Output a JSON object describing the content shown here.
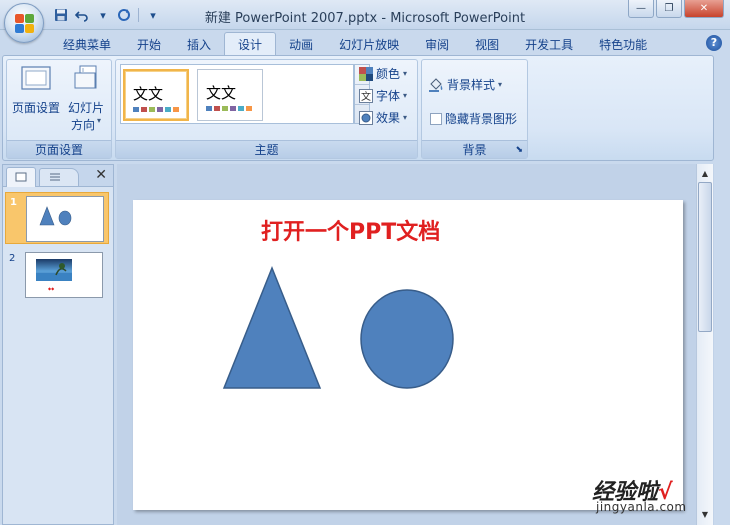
{
  "window": {
    "title": "新建 PowerPoint 2007.pptx - Microsoft PowerPoint",
    "minimize": "—",
    "restore": "❐",
    "close": "✕"
  },
  "quick_access": {
    "save_icon": "save-icon",
    "undo_icon": "undo-icon",
    "redo_icon": "redo-icon",
    "customize_icon": "dropdown-icon"
  },
  "tabs": [
    {
      "label": "经典菜单"
    },
    {
      "label": "开始"
    },
    {
      "label": "插入"
    },
    {
      "label": "设计",
      "active": true
    },
    {
      "label": "动画"
    },
    {
      "label": "幻灯片放映"
    },
    {
      "label": "审阅"
    },
    {
      "label": "视图"
    },
    {
      "label": "开发工具"
    },
    {
      "label": "特色功能"
    }
  ],
  "help": "?",
  "ribbon": {
    "page_setup": {
      "label": "页面设置",
      "page_setup_btn": "页面设置",
      "orientation_btn_line1": "幻灯片",
      "orientation_btn_line2": "方向"
    },
    "themes": {
      "label": "主题",
      "thumbs": [
        {
          "text": "文文",
          "selected": true
        },
        {
          "text": "文文",
          "selected": false
        }
      ],
      "colors": "颜色",
      "fonts": "字体",
      "effects": "效果"
    },
    "background": {
      "label": "背景",
      "styles": "背景样式",
      "hide_graphics": "隐藏背景图形"
    }
  },
  "slides_pane": {
    "slides": [
      {
        "number": "1",
        "selected": true
      },
      {
        "number": "2",
        "selected": false
      }
    ]
  },
  "slide": {
    "title": "打开一个PPT文档",
    "shape_color": "#4f81bd",
    "shape_border": "#385d8a",
    "title_color": "#e02020"
  },
  "watermark": {
    "text": "经验啦",
    "check": "√",
    "url": "jingyanla.com"
  },
  "colors": {
    "theme_swatches": [
      "#4f81bd",
      "#c0504d",
      "#9bbb59",
      "#8064a2",
      "#4bacc6",
      "#f79646"
    ]
  }
}
